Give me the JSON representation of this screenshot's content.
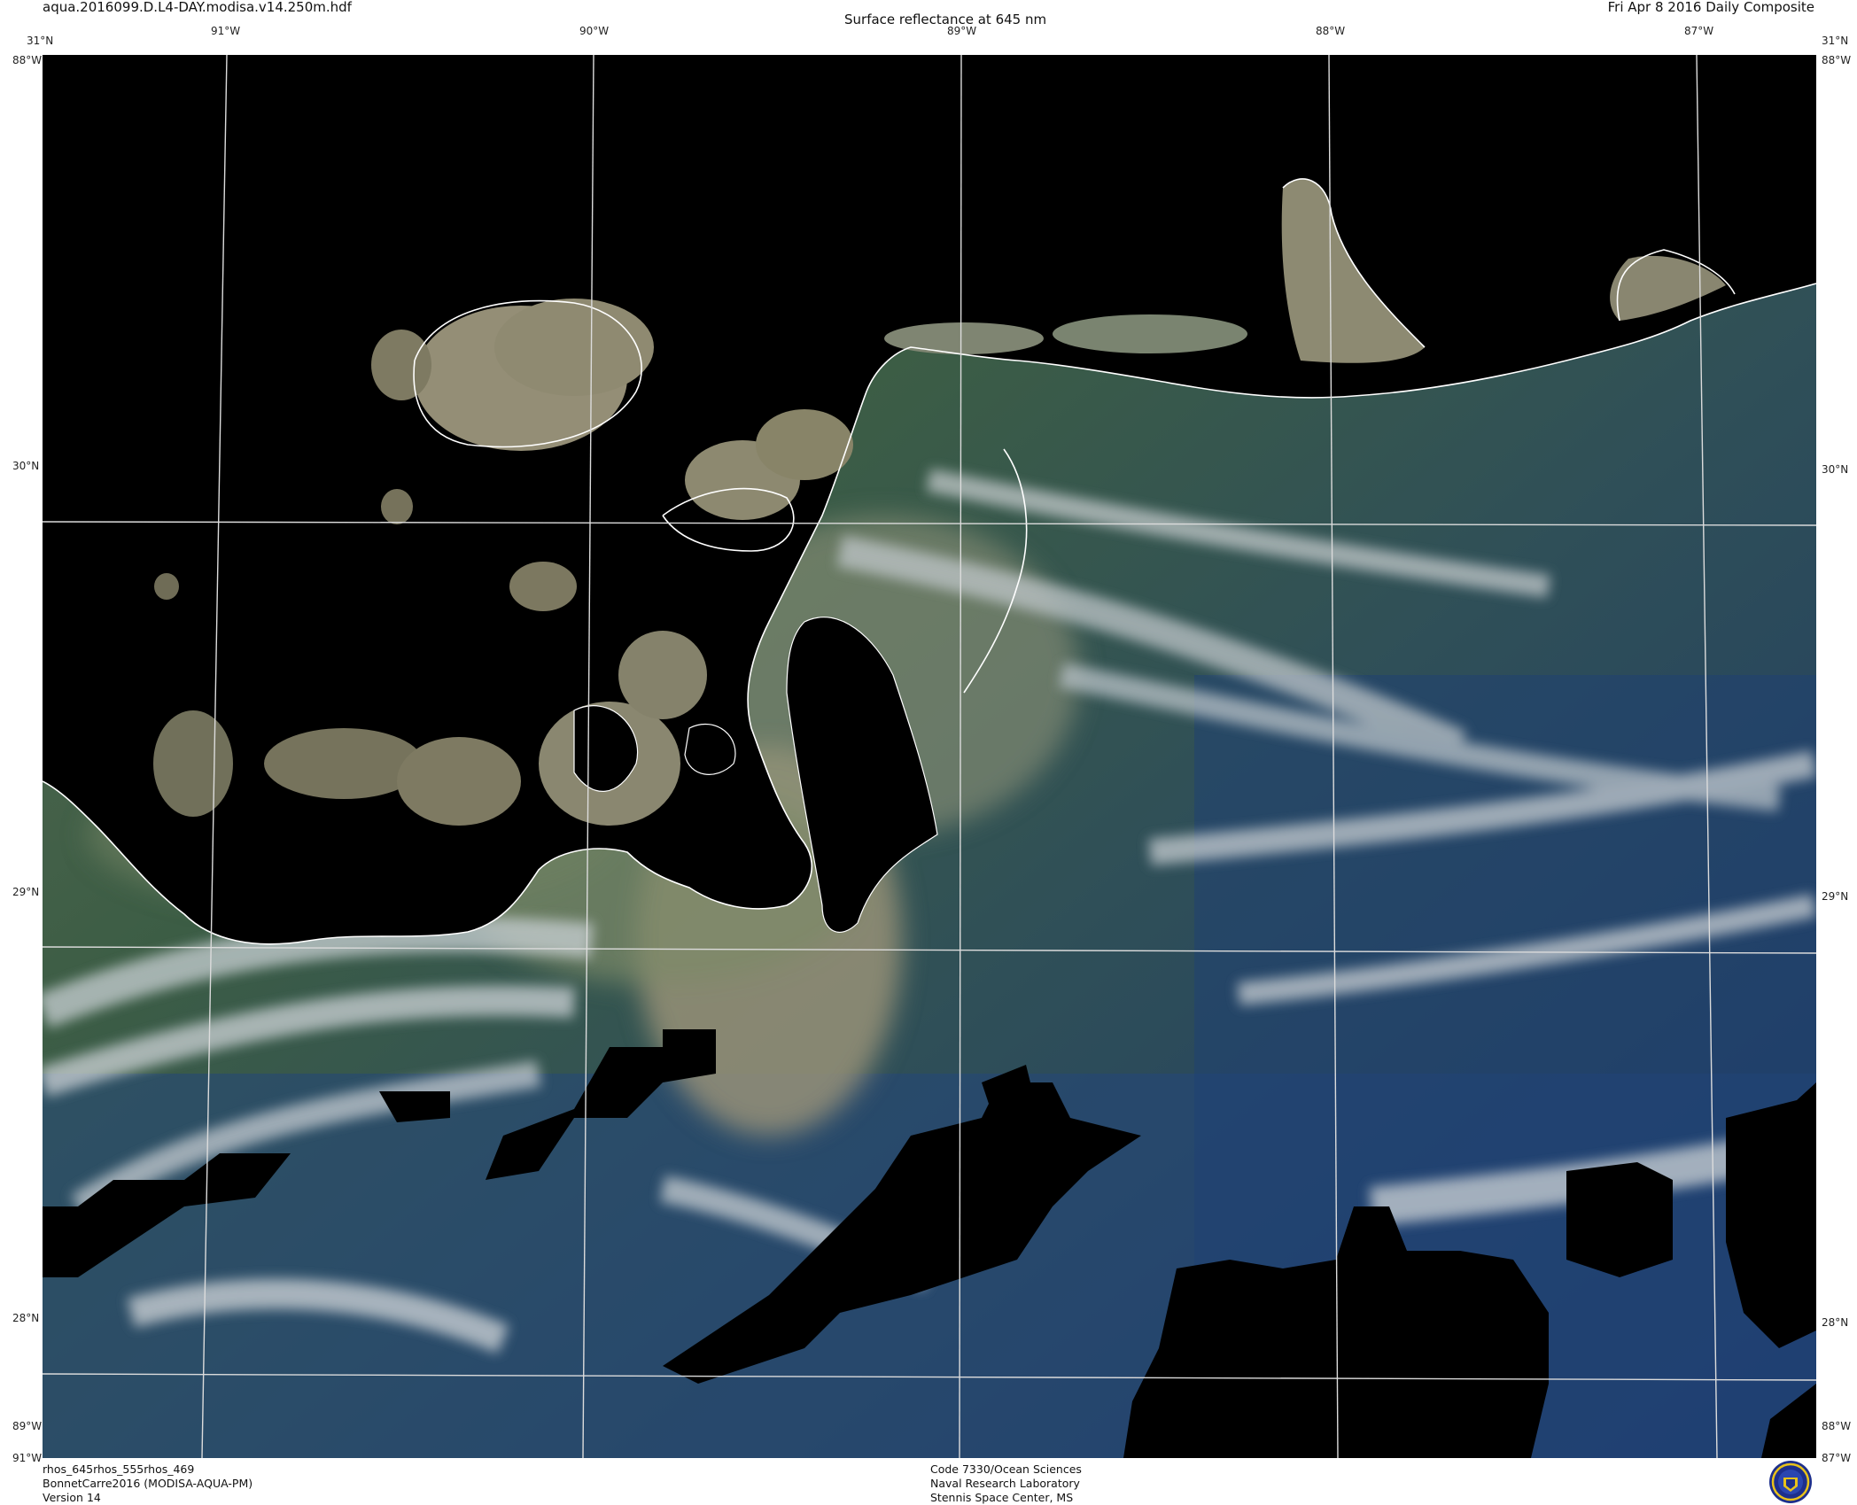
{
  "header": {
    "filename": "aqua.2016099.D.L4-DAY.modisa.v14.250m.hdf",
    "title": "Surface reflectance at 645 nm",
    "date": "Fri Apr  8 2016 Daily Composite"
  },
  "grid": {
    "top_lon_labels": [
      "91°W",
      "90°W",
      "89°W",
      "88°W",
      "87°W"
    ],
    "bottom_lon_labels": [
      "89°W",
      "91°W",
      "88°W",
      "87°W"
    ],
    "lat_labels_left": [
      "31°N",
      "30°N",
      "29°N",
      "28°N"
    ],
    "lat_labels_right": [
      "31°N",
      "30°N",
      "29°N",
      "28°N"
    ],
    "corner_top_left_lat": "31°N",
    "corner_top_left_lon": "88°W",
    "corner_top_right_lat": "31°N",
    "corner_top_right_lon": "88°W"
  },
  "footer": {
    "left": [
      "rhos_645rhos_555rhos_469",
      "BonnetCarre2016 (MODISA-AQUA-PM)",
      "Version 14"
    ],
    "center": [
      "Code 7330/Ocean Sciences",
      "Naval Research Laboratory",
      "Stennis Space Center, MS"
    ]
  },
  "colors": {
    "land_nodata": "#000000",
    "coastline": "#ffffff",
    "gridline": "#d8d8d8",
    "turbid_water": "#8e8b72",
    "shelf_water": "#3a5a42",
    "deep_water": "#1f3f6a",
    "cloud": "#c7ced2"
  }
}
